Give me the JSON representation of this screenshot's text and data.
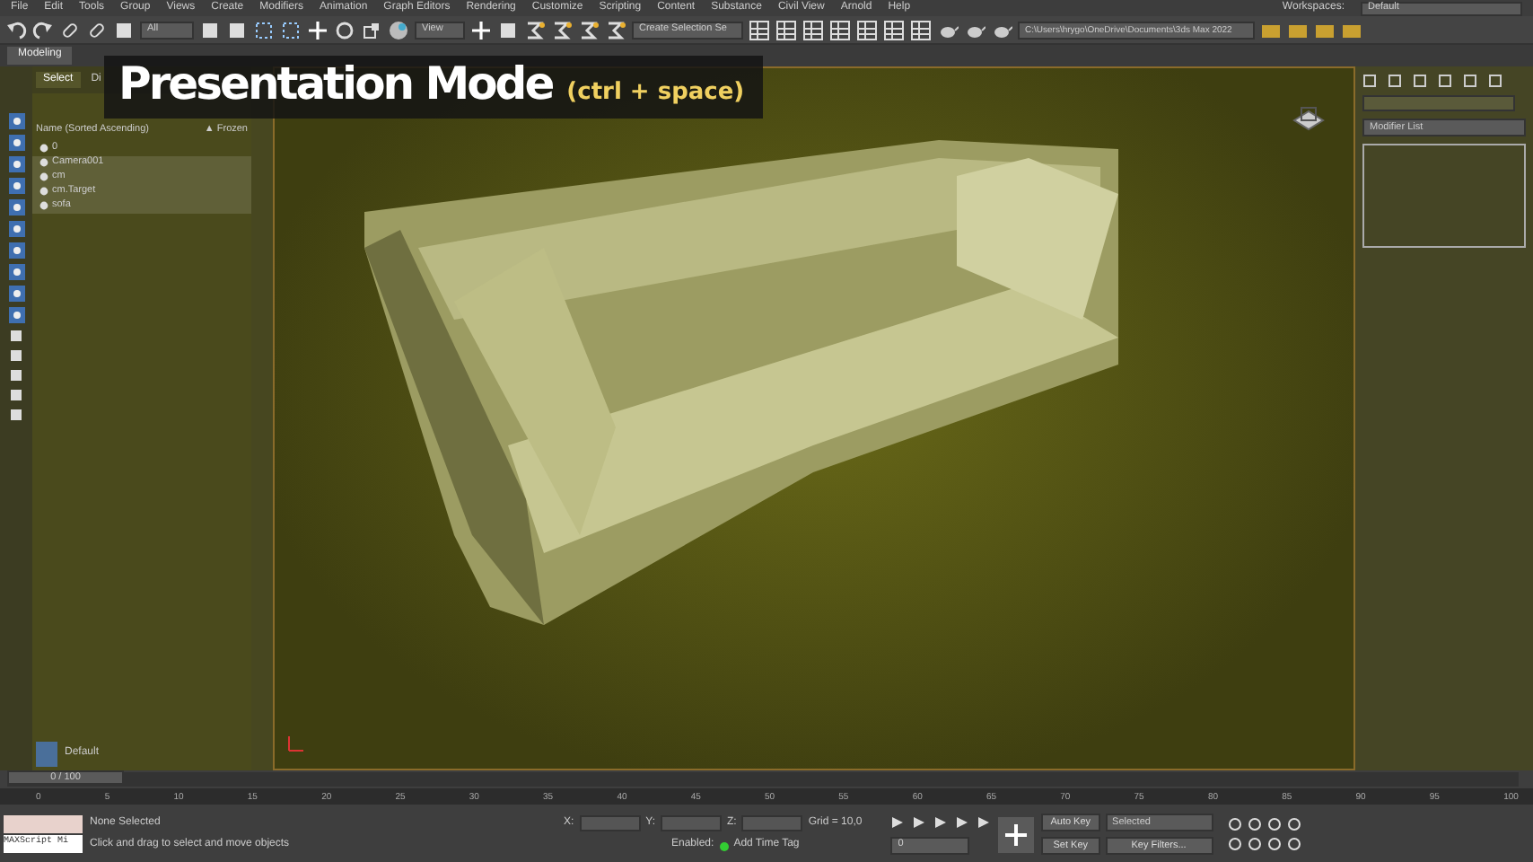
{
  "menu": [
    "File",
    "Edit",
    "Tools",
    "Group",
    "Views",
    "Create",
    "Modifiers",
    "Animation",
    "Graph Editors",
    "Rendering",
    "Customize",
    "Scripting",
    "Content",
    "Substance",
    "Civil View",
    "Arnold",
    "Help"
  ],
  "workspaces": {
    "label": "Workspaces:",
    "value": "Default"
  },
  "toolbar": {
    "filter": "All",
    "ref_coord": "View",
    "selection_set": "Create Selection Se",
    "project_path": "C:\\Users\\hrygo\\OneDrive\\Documents\\3ds Max 2022"
  },
  "ribbon_tabs": [
    {
      "label": "Modeling",
      "selected": true
    }
  ],
  "caption": {
    "title": "Presentation Mode",
    "hint": "(ctrl + space)"
  },
  "scene_explorer": {
    "tabs": [
      {
        "label": "Select",
        "selected": true
      },
      {
        "label": "Di",
        "selected": false
      }
    ],
    "column_1": "Name (Sorted Ascending)",
    "column_2": "▲ Frozen",
    "rows": [
      {
        "name": "0",
        "selected": false
      },
      {
        "name": "Camera001",
        "selected": true
      },
      {
        "name": "cm",
        "selected": true
      },
      {
        "name": "cm.Target",
        "selected": true
      },
      {
        "name": "sofa",
        "selected": true
      }
    ]
  },
  "layer": {
    "name": "Default"
  },
  "modifier_list": "Modifier List",
  "time_slider": {
    "label": "0 / 100",
    "level": 0
  },
  "timeline_ticks": [
    "0",
    "5",
    "10",
    "15",
    "20",
    "25",
    "30",
    "35",
    "40",
    "45",
    "50",
    "55",
    "60",
    "65",
    "70",
    "75",
    "80",
    "85",
    "90",
    "95",
    "100"
  ],
  "status": {
    "script_listener": "MAXScript Mi",
    "selection": "None Selected",
    "prompt": "Click and drag to select and move objects",
    "x_label": "X:",
    "y_label": "Y:",
    "z_label": "Z:",
    "grid": "Grid = 10,0",
    "enabled": "Enabled:",
    "add_time_tag": "Add Time Tag",
    "frame": "0",
    "auto_key": "Auto Key",
    "key_mode": "Selected",
    "set_key": "Set Key",
    "key_filters": "Key Filters..."
  }
}
